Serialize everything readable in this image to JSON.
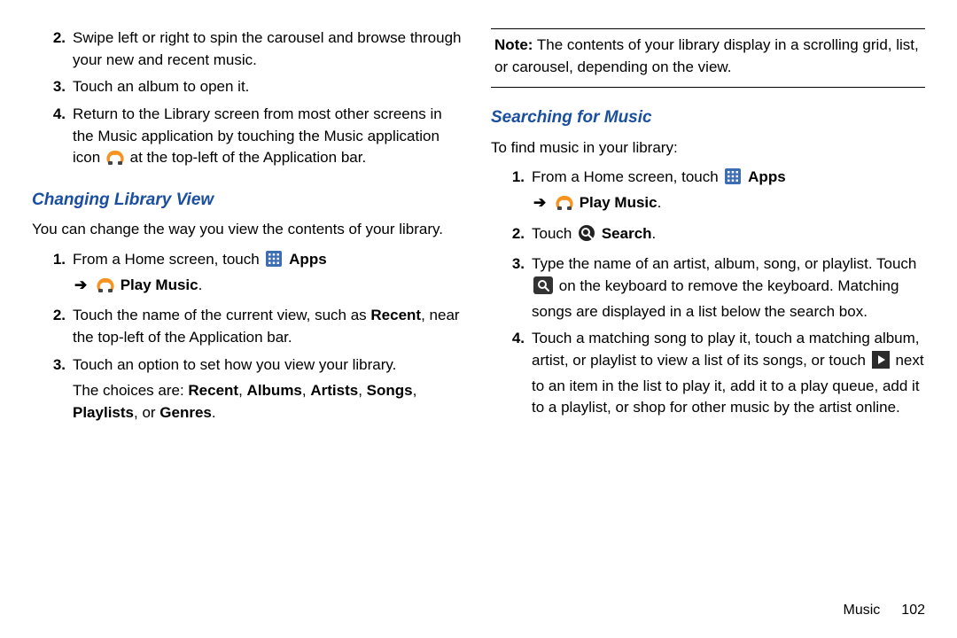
{
  "left": {
    "items_top": [
      {
        "n": "2.",
        "text": "Swipe left or right to spin the carousel and browse through your new and recent music."
      },
      {
        "n": "3.",
        "text": "Touch an album to open it."
      }
    ],
    "item4": {
      "n": "4.",
      "pre": "Return to the Library screen from most other screens in the Music application by touching the Music application icon ",
      "post": " at the top-left of the Application bar."
    },
    "heading": "Changing Library View",
    "intro": "You can change the way you view the contents of your library.",
    "step1": {
      "n": "1.",
      "pre": "From a Home screen, touch ",
      "apps": "Apps",
      "play": "Play Music",
      "dot": "."
    },
    "step2": {
      "n": "2.",
      "a": "Touch the name of the current view, such as ",
      "b": "Recent",
      "c": ", near the top-left of the Application bar."
    },
    "step3": {
      "n": "3.",
      "text": "Touch an option to set how you view your library."
    },
    "choices": {
      "a": "The choices are: ",
      "b": "Recent",
      "c": ", ",
      "d": "Albums",
      "e": ", ",
      "f": "Artists",
      "g": ", ",
      "h": "Songs",
      "i": ", ",
      "j": "Playlists",
      "k": ", or ",
      "l": "Genres",
      "m": "."
    }
  },
  "right": {
    "note": {
      "label": "Note:",
      "text": " The contents of your library display in a scrolling grid, list, or carousel, depending on the view."
    },
    "heading": "Searching for Music",
    "intro": "To find music in your library:",
    "step1": {
      "n": "1.",
      "pre": "From a Home screen, touch ",
      "apps": "Apps",
      "play": "Play Music",
      "dot": "."
    },
    "step2": {
      "n": "2.",
      "pre": "Touch ",
      "search": "Search",
      "dot": "."
    },
    "step3": {
      "n": "3.",
      "a": "Type the name of an artist, album, song, or playlist. Touch ",
      "b": " on the keyboard to remove the keyboard. Matching songs are displayed in a list below the search box."
    },
    "step4": {
      "n": "4.",
      "a": "Touch a matching song to play it, touch a matching album, artist, or playlist to view a list of its songs, or touch ",
      "b": " next to an item in the list to play it, add it to a play queue, add it to a playlist, or shop for other music by the artist online."
    }
  },
  "footer": {
    "section": "Music",
    "page": "102"
  },
  "glyphs": {
    "arrow": "➔"
  }
}
